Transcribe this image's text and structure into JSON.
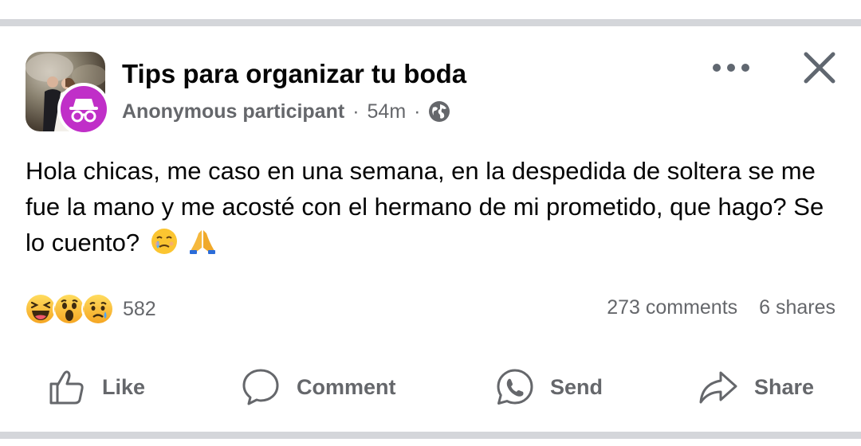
{
  "post": {
    "group_name": "Tips para organizar tu boda",
    "author": "Anonymous participant",
    "separator": "·",
    "time": "54m",
    "body_text": "Hola chicas, me caso en una semana, en la despedida de soltera se me fue la mano y me acosté con el hermano de mi prometido, que hago? Se lo cuento?",
    "body_emojis": [
      "face-holding-back-tears",
      "folded-hands"
    ]
  },
  "icons": {
    "more": "more-horizontal-icon",
    "close": "close-icon",
    "audience": "globe-icon",
    "anonymous": "incognito-icon"
  },
  "reactions": {
    "types": [
      "haha",
      "wow",
      "sad"
    ],
    "count": "582"
  },
  "stats": {
    "comments": "273 comments",
    "shares": "6 shares"
  },
  "actions": {
    "like": "Like",
    "comment": "Comment",
    "send": "Send",
    "share": "Share"
  },
  "colors": {
    "anon_badge": "#c02fc8",
    "secondary_text": "#65676b",
    "divider": "#d4d6da"
  }
}
